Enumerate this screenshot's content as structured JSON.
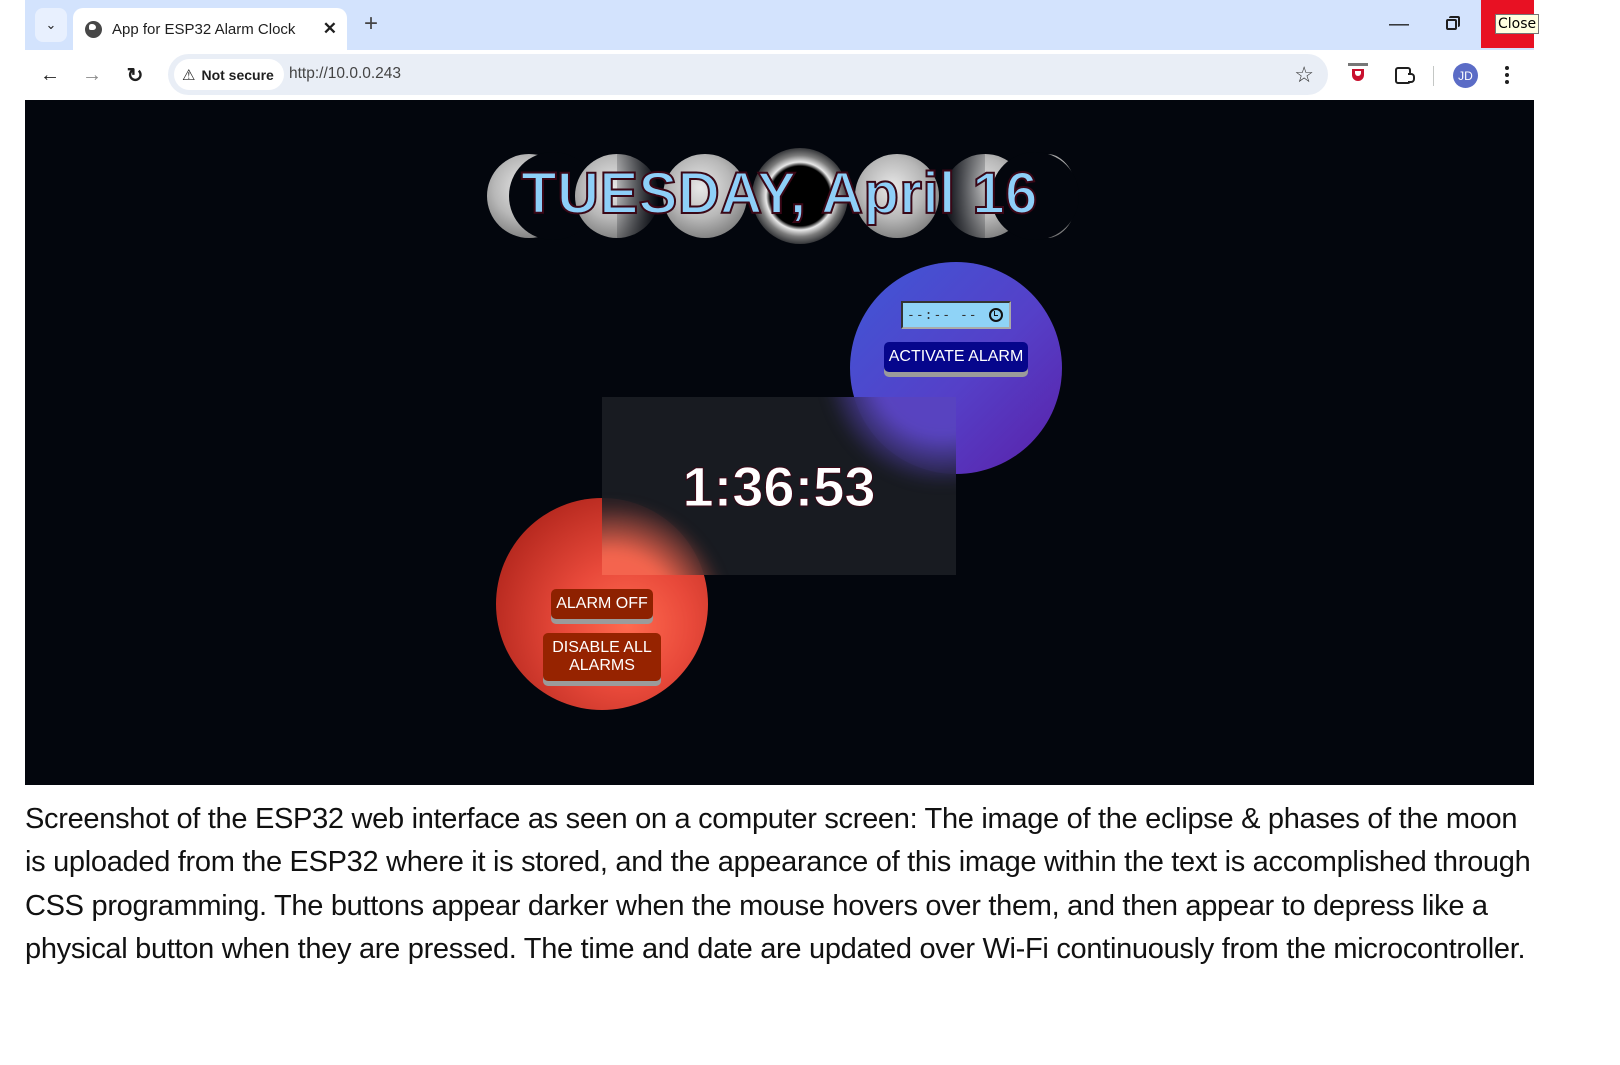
{
  "browser": {
    "tab": {
      "title": "App for ESP32 Alarm Clock",
      "close_glyph": "✕",
      "favicon": "globe-icon"
    },
    "new_tab_glyph": "+",
    "tab_search_glyph": "⌄",
    "window_controls": {
      "minimize_glyph": "—",
      "close_tooltip": "Close"
    },
    "nav": {
      "back_glyph": "←",
      "forward_glyph": "→",
      "reload_glyph": "↻"
    },
    "security_chip": {
      "icon_glyph": "⚠",
      "label": "Not secure"
    },
    "url": "http://10.0.0.243",
    "bookmark_glyph": "☆",
    "profile_initials": "JD",
    "colors": {
      "tabstrip": "#d3e3fd",
      "close_red": "#e81123",
      "avatar": "#5b6cc6"
    }
  },
  "app": {
    "date_text": "TUESDAY, April 16",
    "clock_time": "1:36:53",
    "alarm_time_input": {
      "placeholder_display": "--:-- --",
      "value": ""
    },
    "buttons": {
      "activate": "ACTIVATE ALARM",
      "alarm_off": "ALARM OFF",
      "disable_all": "DISABLE ALL ALARMS"
    },
    "colors": {
      "background": "#03060d",
      "date_fill": "#8ecff8",
      "date_outline": "#3a0716",
      "activate_button": "#06068c",
      "red_buttons": "#8e2100",
      "time_input_bg": "#8fd3f7",
      "blue_circle": "#4a4ad0",
      "red_circle": "#e8493a"
    }
  },
  "caption": "Screenshot of the ESP32 web interface as seen on a computer screen: The image of the eclipse & phases of the moon is uploaded from the ESP32 where it is stored, and the appearance of this image within the text is accomplished through CSS programming. The buttons appear darker when the mouse hovers over them, and then appear to depress like a physical button when they are pressed. The time and date are updated over Wi-Fi continuously from the microcontroller."
}
